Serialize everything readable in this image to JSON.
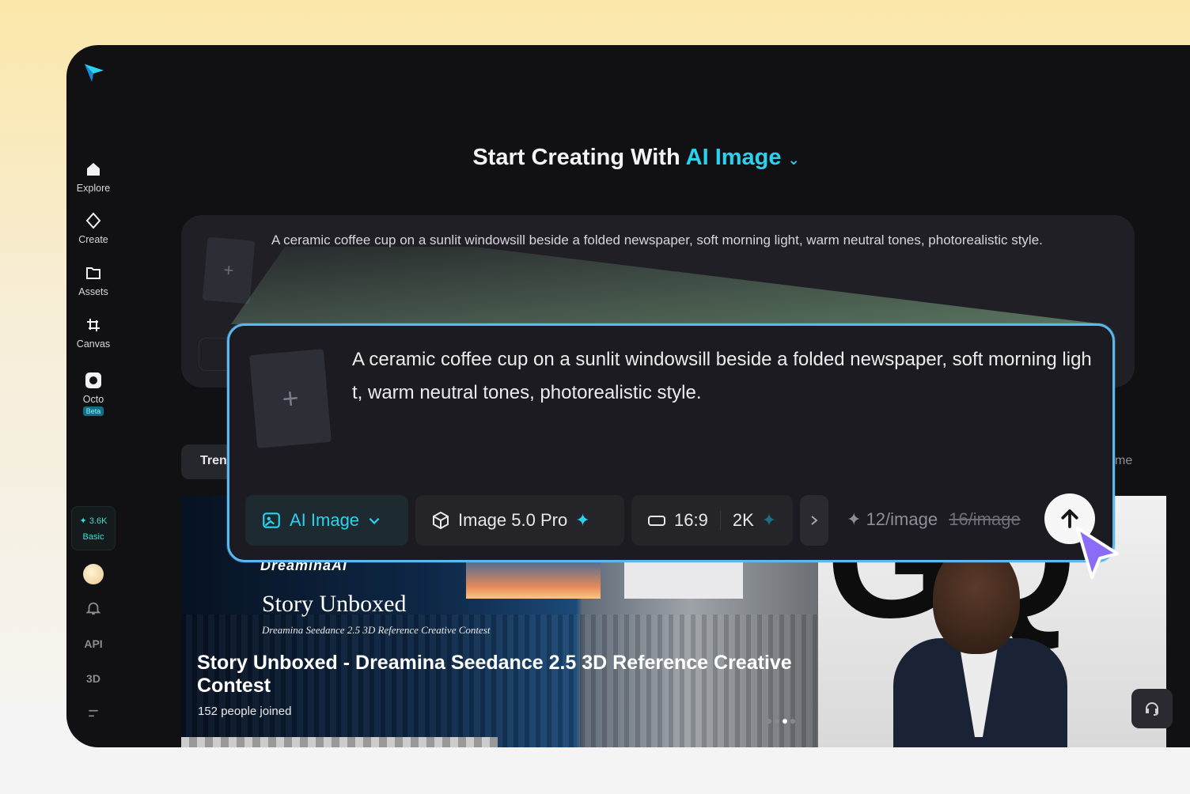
{
  "sidebar": {
    "items": [
      {
        "label": "Explore"
      },
      {
        "label": "Create"
      },
      {
        "label": "Assets"
      },
      {
        "label": "Canvas"
      },
      {
        "label": "Octo",
        "badge": "Beta"
      }
    ],
    "credits": {
      "amount": "3.6K",
      "plan": "Basic"
    },
    "api_label": "API",
    "three_d_label": "3D"
  },
  "header": {
    "prefix": "Start Creating With",
    "mode": "AI Image"
  },
  "prompt": {
    "text": "A ceramic coffee cup on a sunlit windowsill beside a folded newspaper, soft morning light, warm neutral tones, photorealistic style.",
    "zoom_text": "A ceramic coffee cup on a sunlit windowsill beside a folded newspaper, soft morning light, warm neutral tones, photorealistic style."
  },
  "toolbar": {
    "mode_label": "AI Image",
    "model_label": "Image 5.0 Pro",
    "ratio": "16:9",
    "resolution": "2K",
    "cost": "12/image",
    "cost_original": "16/image"
  },
  "tabs": {
    "trending_partial": "Tren",
    "right_partial": "me"
  },
  "banner": {
    "logo": "DreaminaAI",
    "story": "Story Unboxed",
    "subtitle": "Dreamina Seedance 2.5 3D Reference Creative Contest",
    "title": "Story Unboxed - Dreamina Seedance 2.5 3D Reference Creative Contest",
    "joined": "152 people joined"
  },
  "gq": {
    "letters": "GQ"
  },
  "colors": {
    "accent": "#2bd2f0",
    "highlight_border": "#59b8f0",
    "cursor": "#8b6cf6"
  }
}
